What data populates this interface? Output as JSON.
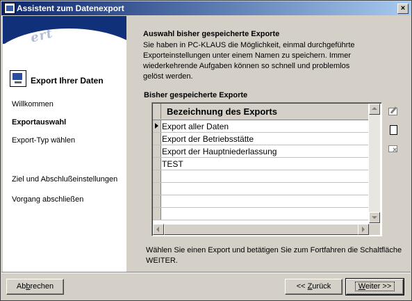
{
  "window": {
    "title": "Assistent zum Datenexport",
    "close_label": "×"
  },
  "sidebar": {
    "banner_word": "ert",
    "heading": "Export Ihrer Daten",
    "steps": [
      {
        "label": "Willkommen",
        "active": false
      },
      {
        "label": "Exportauswahl",
        "active": true
      },
      {
        "label": "Export-Typ wählen",
        "active": false
      },
      {
        "label": "Ziel und Abschlußeinstellungen",
        "active": false
      },
      {
        "label": "Vorgang abschließen",
        "active": false
      }
    ]
  },
  "main": {
    "section_title": "Auswahl bisher gespeicherte Exporte",
    "description": "Sie haben in PC-KLAUS die Möglichkeit, einmal durchgeführte Exporteinstellungen unter einem Namen zu speichern. Immer wiederkehrende Aufgaben können so schnell und problemlos gelöst werden.",
    "list_label": "Bisher gespeicherte Exporte",
    "grid": {
      "column_header": "Bezeichnung des Exports",
      "rows": [
        "Export aller Daten",
        "Export der Betriebsstätte",
        "Export der Hauptniederlassung",
        "TEST"
      ],
      "selected_row": 0
    },
    "tools": [
      "edit-export-icon",
      "new-export-icon",
      "delete-export-icon"
    ],
    "hint": "Wählen Sie einen Export und betätigen Sie zum Fortfahren die Schaltfläche WEITER."
  },
  "buttons": {
    "cancel_pre": "Ab",
    "cancel_key": "b",
    "cancel_post": "rechen",
    "back_pre": "<< ",
    "back_key": "Z",
    "back_post": "urück",
    "next_key": "W",
    "next_post": "eiter >>"
  }
}
